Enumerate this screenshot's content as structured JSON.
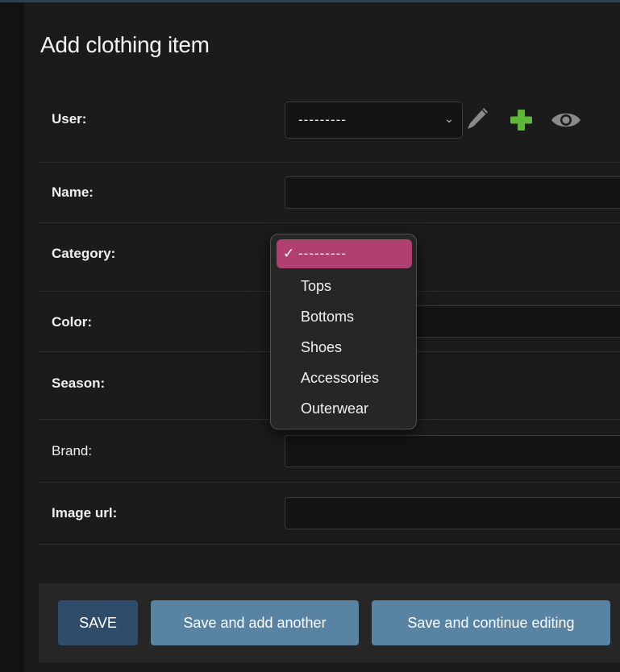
{
  "page": {
    "title": "Add clothing item"
  },
  "fields": {
    "user": {
      "label": "User:",
      "value": "---------"
    },
    "name": {
      "label": "Name:"
    },
    "category": {
      "label": "Category:"
    },
    "color": {
      "label": "Color:"
    },
    "season": {
      "label": "Season:"
    },
    "brand": {
      "label": "Brand:"
    },
    "image_url": {
      "label": "Image url:"
    }
  },
  "user_actions": {
    "icons": [
      "pencil-icon",
      "plus-icon",
      "eye-icon"
    ],
    "colors": {
      "plus": "#5fb63a",
      "muted": "#8a8a8a"
    }
  },
  "category_dropdown": {
    "selected": "---------",
    "options": [
      "Tops",
      "Bottoms",
      "Shoes",
      "Accessories",
      "Outerwear"
    ],
    "highlight_color": "#b0406f"
  },
  "submit": {
    "save": "SAVE",
    "save_add_another": "Save and add another",
    "save_continue": "Save and continue editing"
  },
  "colors": {
    "background": "#1b1b1b",
    "primary_button": "#2f4d6a",
    "secondary_button": "#5883a3"
  }
}
